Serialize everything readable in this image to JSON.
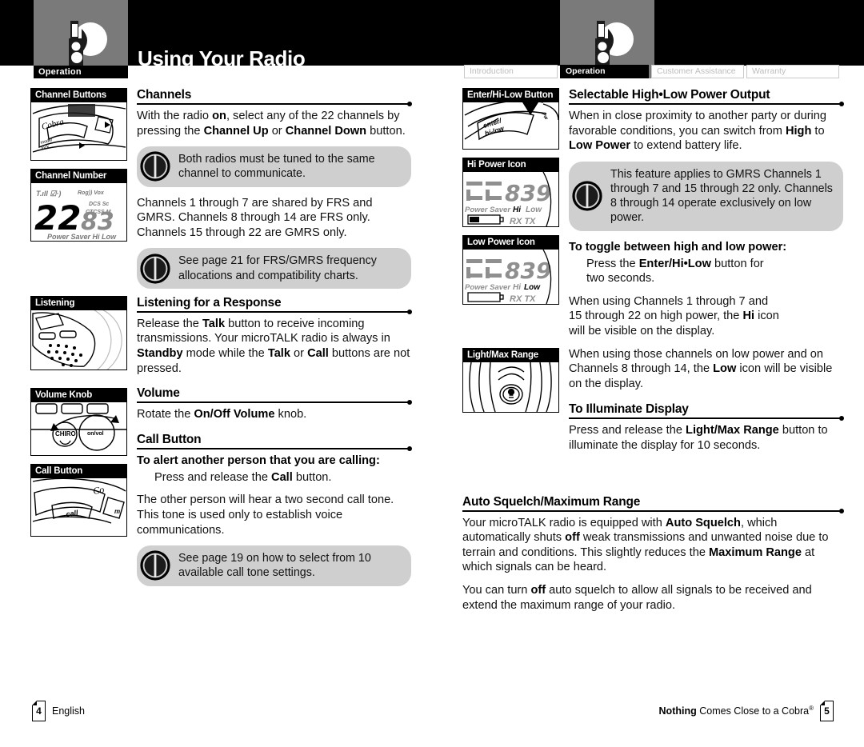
{
  "header": {
    "title": "Using Your Radio",
    "section_tab_left": "Operation",
    "section_tab_right": "Operation",
    "logo_icon": "cobra-radio-logo",
    "nav_tabs": [
      {
        "label": "Introduction",
        "active": false
      },
      {
        "label": "Operation",
        "active": true
      },
      {
        "label": "Customer Assistance",
        "active": false
      },
      {
        "label": "Warranty",
        "active": false
      }
    ]
  },
  "left_page": {
    "figures": {
      "channel_buttons": "Channel Buttons",
      "channel_number": "Channel Number",
      "listening": "Listening",
      "volume_knob": "Volume Knob",
      "call_button": "Call Button"
    },
    "sections": [
      {
        "heading": "Channels",
        "paragraph_1_pre": "With the radio ",
        "paragraph_1": "With the radio on, select any of the 22 channels by pressing the Channel Up or Channel Down button.",
        "note_1": "Both radios must be tuned to the same channel to communicate.",
        "paragraph_2": "Channels 1 through 7 are shared by FRS and GMRS. Channels 8 through 14 are FRS only. Channels 15 through 22 are GMRS only.",
        "note_2": "See page 21 for FRS/GMRS frequency allocations and compatibility charts."
      },
      {
        "heading": "Listening for a Response",
        "paragraph_1": "Release the Talk button to receive incoming transmissions. Your microTALK radio is always in Standby mode while the Talk or Call buttons are not pressed."
      },
      {
        "heading": "Volume",
        "paragraph_1": "Rotate the On/Off Volume knob."
      },
      {
        "heading": "Call Button",
        "subheading": "To alert another person that you are calling:",
        "paragraph_1": "Press and release the Call button.",
        "paragraph_2": "The other person will hear a two second call tone. This tone is used only to establish voice communications.",
        "note_1": "See page 19 on how to select from 10 available call tone settings."
      }
    ]
  },
  "right_page": {
    "figures": {
      "enter_hi_low_button": "Enter/Hi-Low Button",
      "hi_power_icon": "Hi Power Icon",
      "low_power_icon": "Low Power Icon",
      "light_max_range": "Light/Max Range"
    },
    "display_labels": {
      "power_saver": "Power Saver",
      "hi": "Hi",
      "low": "Low",
      "rx": "RX",
      "tx": "TX",
      "channel_digits": "839"
    },
    "sections": [
      {
        "heading": "Selectable High•Low Power Output",
        "paragraph_1": "When in close proximity to another party or during favorable conditions, you can switch from High to Low Power to extend battery life.",
        "note_1": "This feature applies to GMRS Channels 1 through 7 and 15 through 22 only. Channels 8 through 14 operate exclusively on low power.",
        "subheading": "To toggle between high and low power:",
        "paragraph_2": "Press the Enter/Hi•Low button for two seconds.",
        "paragraph_3": "When using Channels 1 through 7 and 15 through 22 on high power, the Hi icon will be visible on the display.",
        "paragraph_4": "When using those channels on low power and on Channels 8 through 14, the Low icon will be visible on the display."
      },
      {
        "heading": "To Illuminate Display",
        "paragraph_1": "Press and release the Light/Max Range button to illuminate the display for 10 seconds."
      },
      {
        "heading": "Auto Squelch/Maximum Range",
        "paragraph_1": "Your microTALK radio is equipped with Auto Squelch, which automatically shuts off weak transmissions and unwanted noise due to terrain and conditions. This slightly reduces the Maximum Range at which signals can be heard.",
        "paragraph_2": "You can turn off auto squelch to allow all signals to be received and extend the maximum range of your radio."
      }
    ]
  },
  "footer": {
    "left_page_number": "4",
    "left_label": "English",
    "right_tagline_bold": "Nothing",
    "right_tagline_rest": " Comes Close to a Cobra",
    "right_tagline_sup": "®",
    "right_page_number": "5"
  },
  "colors": {
    "header_black": "#000000",
    "logo_gray": "#7a7a7a",
    "note_gray": "#cfcfcf",
    "tab_inactive_text": "#bdbdbd"
  }
}
